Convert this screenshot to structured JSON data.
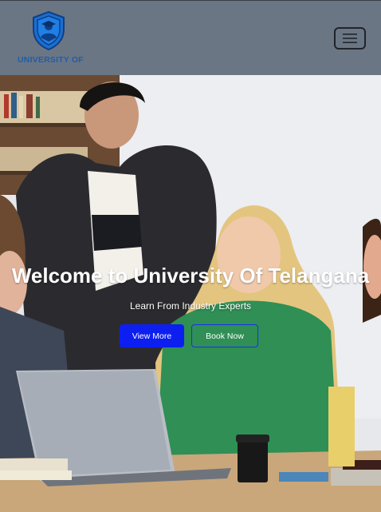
{
  "header": {
    "logo_text": "UNIVERSITY OF",
    "menu_icon": "hamburger-menu-icon"
  },
  "hero": {
    "title": "Welcome to University Of Telangana",
    "subtitle": "Learn From Industry Experts",
    "primary_button": "View More",
    "secondary_button": "Book Now"
  },
  "colors": {
    "header_bg": "#6b7684",
    "logo_blue": "#1e5ea8",
    "button_blue": "#0d1ff0"
  }
}
